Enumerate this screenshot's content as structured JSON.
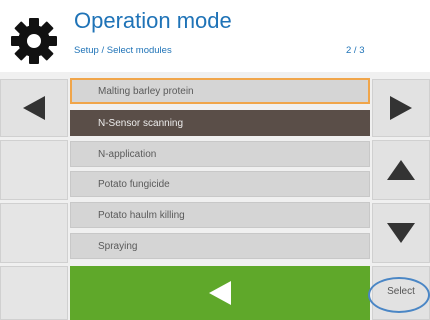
{
  "header": {
    "title": "Operation mode",
    "breadcrumb": "Setup / Select modules",
    "pager": "2 / 3",
    "icon": "gear-icon"
  },
  "list": {
    "items": [
      {
        "label": "Malting barley protein",
        "state": "focused"
      },
      {
        "label": "N-Sensor scanning",
        "state": "selected"
      },
      {
        "label": "N-application",
        "state": "normal"
      },
      {
        "label": "Potato fungicide",
        "state": "normal"
      },
      {
        "label": "Potato haulm killing",
        "state": "normal"
      },
      {
        "label": "Spraying",
        "state": "normal"
      }
    ]
  },
  "buttons": {
    "select_label": "Select",
    "prev_page_icon": "arrow-left-icon",
    "next_page_icon": "arrow-right-icon",
    "scroll_up_icon": "arrow-up-icon",
    "scroll_down_icon": "arrow-down-icon",
    "back_icon": "back-arrow-icon"
  },
  "colors": {
    "title": "#1f73b7",
    "focus_border": "#f0a54a",
    "selected_bg": "#5a4e48",
    "back_button": "#5fa82a",
    "select_ring": "#4a86c5"
  }
}
